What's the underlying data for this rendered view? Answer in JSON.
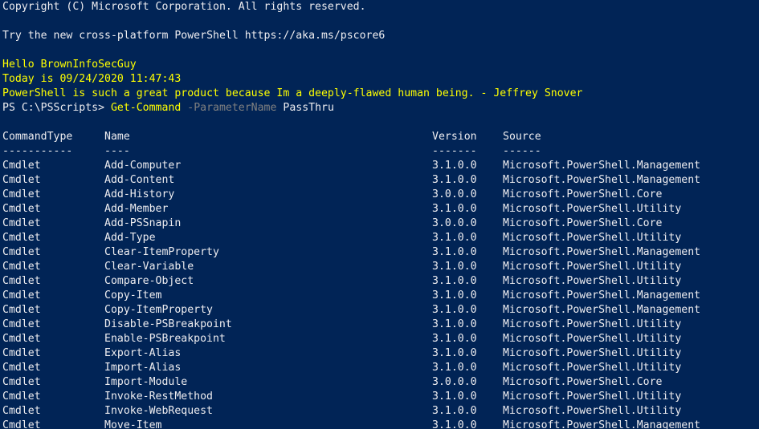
{
  "console": {
    "copyright": "Copyright (C) Microsoft Corporation. All rights reserved.",
    "try_new": "Try the new cross-platform PowerShell https://aka.ms/pscore6",
    "greeting": "Hello BrownInfoSecGuy",
    "today": "Today is 09/24/2020 11:47:43",
    "quote": "PowerShell is such a great product because Im a deeply-flawed human being. - Jeffrey Snover",
    "prompt": "PS C:\\PSScripts> ",
    "command": "Get-Command",
    "parameter": "-ParameterName",
    "argument": "PassThru",
    "colors": {
      "background": "#012456",
      "text": "#eeedf0",
      "highlight": "#ffff00",
      "parameter": "#808080"
    }
  },
  "table": {
    "headers": [
      "CommandType",
      "Name",
      "Version",
      "Source"
    ],
    "separators": [
      "-----------",
      "----",
      "-------",
      "------"
    ],
    "rows": [
      [
        "Cmdlet",
        "Add-Computer",
        "3.1.0.0",
        "Microsoft.PowerShell.Management"
      ],
      [
        "Cmdlet",
        "Add-Content",
        "3.1.0.0",
        "Microsoft.PowerShell.Management"
      ],
      [
        "Cmdlet",
        "Add-History",
        "3.0.0.0",
        "Microsoft.PowerShell.Core"
      ],
      [
        "Cmdlet",
        "Add-Member",
        "3.1.0.0",
        "Microsoft.PowerShell.Utility"
      ],
      [
        "Cmdlet",
        "Add-PSSnapin",
        "3.0.0.0",
        "Microsoft.PowerShell.Core"
      ],
      [
        "Cmdlet",
        "Add-Type",
        "3.1.0.0",
        "Microsoft.PowerShell.Utility"
      ],
      [
        "Cmdlet",
        "Clear-ItemProperty",
        "3.1.0.0",
        "Microsoft.PowerShell.Management"
      ],
      [
        "Cmdlet",
        "Clear-Variable",
        "3.1.0.0",
        "Microsoft.PowerShell.Utility"
      ],
      [
        "Cmdlet",
        "Compare-Object",
        "3.1.0.0",
        "Microsoft.PowerShell.Utility"
      ],
      [
        "Cmdlet",
        "Copy-Item",
        "3.1.0.0",
        "Microsoft.PowerShell.Management"
      ],
      [
        "Cmdlet",
        "Copy-ItemProperty",
        "3.1.0.0",
        "Microsoft.PowerShell.Management"
      ],
      [
        "Cmdlet",
        "Disable-PSBreakpoint",
        "3.1.0.0",
        "Microsoft.PowerShell.Utility"
      ],
      [
        "Cmdlet",
        "Enable-PSBreakpoint",
        "3.1.0.0",
        "Microsoft.PowerShell.Utility"
      ],
      [
        "Cmdlet",
        "Export-Alias",
        "3.1.0.0",
        "Microsoft.PowerShell.Utility"
      ],
      [
        "Cmdlet",
        "Import-Alias",
        "3.1.0.0",
        "Microsoft.PowerShell.Utility"
      ],
      [
        "Cmdlet",
        "Import-Module",
        "3.0.0.0",
        "Microsoft.PowerShell.Core"
      ],
      [
        "Cmdlet",
        "Invoke-RestMethod",
        "3.1.0.0",
        "Microsoft.PowerShell.Utility"
      ],
      [
        "Cmdlet",
        "Invoke-WebRequest",
        "3.1.0.0",
        "Microsoft.PowerShell.Utility"
      ],
      [
        "Cmdlet",
        "Move-Item",
        "3.1.0.0",
        "Microsoft.PowerShell.Management"
      ]
    ]
  }
}
